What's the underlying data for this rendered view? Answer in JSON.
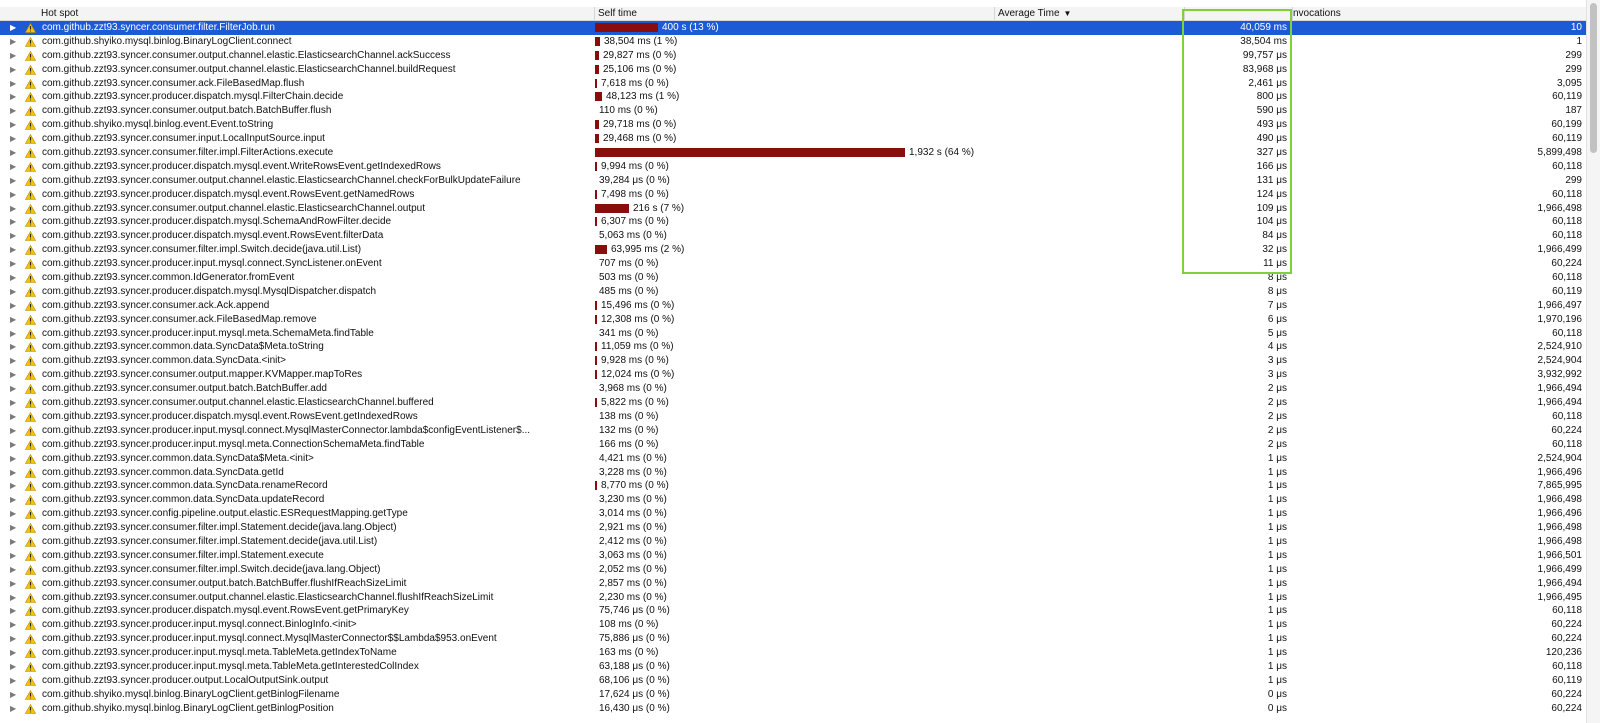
{
  "colors": {
    "selection": "#1d5bd6",
    "bar": "#8a0d0d",
    "highlight": "#7fd13a",
    "warning_icon": "#f5c400"
  },
  "header": {
    "hot_spot": "Hot spot",
    "self_time": "Self time",
    "average_time": "Average Time",
    "sort_icon": "sort-descending-icon",
    "invocations": "nvocations"
  },
  "rows": [
    {
      "method": "com.github.zzt93.syncer.consumer.filter.FilterJob.run",
      "self_time": "400 s (13 %)",
      "self_pct": 13,
      "avg": "40,059 ms",
      "inv": "10"
    },
    {
      "method": "com.github.shyiko.mysql.binlog.BinaryLogClient.connect",
      "self_time": "38,504 ms (1 %)",
      "self_pct": 1,
      "avg": "38,504 ms",
      "inv": "1"
    },
    {
      "method": "com.github.zzt93.syncer.consumer.output.channel.elastic.ElasticsearchChannel.ackSuccess",
      "self_time": "29,827 ms (0 %)",
      "self_pct": 0.9,
      "avg": "99,757 μs",
      "inv": "299"
    },
    {
      "method": "com.github.zzt93.syncer.consumer.output.channel.elastic.ElasticsearchChannel.buildRequest",
      "self_time": "25,106 ms (0 %)",
      "self_pct": 0.8,
      "avg": "83,968 μs",
      "inv": "299"
    },
    {
      "method": "com.github.zzt93.syncer.consumer.ack.FileBasedMap.flush",
      "self_time": "7,618 ms (0 %)",
      "self_pct": 0.25,
      "avg": "2,461 μs",
      "inv": "3,095"
    },
    {
      "method": "com.github.zzt93.syncer.producer.dispatch.mysql.FilterChain.decide",
      "self_time": "48,123 ms (1 %)",
      "self_pct": 1.5,
      "avg": "800 μs",
      "inv": "60,119"
    },
    {
      "method": "com.github.zzt93.syncer.consumer.output.batch.BatchBuffer.flush",
      "self_time": "110 ms (0 %)",
      "self_pct": 0,
      "avg": "590 μs",
      "inv": "187"
    },
    {
      "method": "com.github.shyiko.mysql.binlog.event.Event.toString",
      "self_time": "29,718 ms (0 %)",
      "self_pct": 0.9,
      "avg": "493 μs",
      "inv": "60,199"
    },
    {
      "method": "com.github.zzt93.syncer.consumer.input.LocalInputSource.input",
      "self_time": "29,468 ms (0 %)",
      "self_pct": 0.9,
      "avg": "490 μs",
      "inv": "60,119"
    },
    {
      "method": "com.github.zzt93.syncer.consumer.filter.impl.FilterActions.execute",
      "self_time": "1,932 s (64 %)",
      "self_pct": 64,
      "avg": "327 μs",
      "inv": "5,899,498"
    },
    {
      "method": "com.github.zzt93.syncer.producer.dispatch.mysql.event.WriteRowsEvent.getIndexedRows",
      "self_time": "9,994 ms (0 %)",
      "self_pct": 0.3,
      "avg": "166 μs",
      "inv": "60,118"
    },
    {
      "method": "com.github.zzt93.syncer.consumer.output.channel.elastic.ElasticsearchChannel.checkForBulkUpdateFailure",
      "self_time": "39,284 μs (0 %)",
      "self_pct": 0,
      "avg": "131 μs",
      "inv": "299"
    },
    {
      "method": "com.github.zzt93.syncer.producer.dispatch.mysql.event.RowsEvent.getNamedRows",
      "self_time": "7,498 ms (0 %)",
      "self_pct": 0.25,
      "avg": "124 μs",
      "inv": "60,118"
    },
    {
      "method": "com.github.zzt93.syncer.consumer.output.channel.elastic.ElasticsearchChannel.output",
      "self_time": "216 s (7 %)",
      "self_pct": 7,
      "avg": "109 μs",
      "inv": "1,966,498"
    },
    {
      "method": "com.github.zzt93.syncer.producer.dispatch.mysql.SchemaAndRowFilter.decide",
      "self_time": "6,307 ms (0 %)",
      "self_pct": 0.2,
      "avg": "104 μs",
      "inv": "60,118"
    },
    {
      "method": "com.github.zzt93.syncer.producer.dispatch.mysql.event.RowsEvent.filterData",
      "self_time": "5,063 ms (0 %)",
      "self_pct": 0,
      "avg": "84 μs",
      "inv": "60,118"
    },
    {
      "method": "com.github.zzt93.syncer.consumer.filter.impl.Switch.decide(java.util.List)",
      "self_time": "63,995 ms (2 %)",
      "self_pct": 2.5,
      "avg": "32 μs",
      "inv": "1,966,499"
    },
    {
      "method": "com.github.zzt93.syncer.producer.input.mysql.connect.SyncListener.onEvent",
      "self_time": "707 ms (0 %)",
      "self_pct": 0,
      "avg": "11 μs",
      "inv": "60,224"
    },
    {
      "method": "com.github.zzt93.syncer.common.IdGenerator.fromEvent",
      "self_time": "503 ms (0 %)",
      "self_pct": 0,
      "avg": "8 μs",
      "inv": "60,118"
    },
    {
      "method": "com.github.zzt93.syncer.producer.dispatch.mysql.MysqlDispatcher.dispatch",
      "self_time": "485 ms (0 %)",
      "self_pct": 0,
      "avg": "8 μs",
      "inv": "60,119"
    },
    {
      "method": "com.github.zzt93.syncer.consumer.ack.Ack.append",
      "self_time": "15,496 ms (0 %)",
      "self_pct": 0.4,
      "avg": "7 μs",
      "inv": "1,966,497"
    },
    {
      "method": "com.github.zzt93.syncer.consumer.ack.FileBasedMap.remove",
      "self_time": "12,308 ms (0 %)",
      "self_pct": 0.35,
      "avg": "6 μs",
      "inv": "1,970,196"
    },
    {
      "method": "com.github.zzt93.syncer.producer.input.mysql.meta.SchemaMeta.findTable",
      "self_time": "341 ms (0 %)",
      "self_pct": 0,
      "avg": "5 μs",
      "inv": "60,118"
    },
    {
      "method": "com.github.zzt93.syncer.common.data.SyncData$Meta.toString",
      "self_time": "11,059 ms (0 %)",
      "self_pct": 0.35,
      "avg": "4 μs",
      "inv": "2,524,910"
    },
    {
      "method": "com.github.zzt93.syncer.common.data.SyncData.<init>",
      "self_time": "9,928 ms (0 %)",
      "self_pct": 0.3,
      "avg": "3 μs",
      "inv": "2,524,904"
    },
    {
      "method": "com.github.zzt93.syncer.consumer.output.mapper.KVMapper.mapToRes",
      "self_time": "12,024 ms (0 %)",
      "self_pct": 0.35,
      "avg": "3 μs",
      "inv": "3,932,992"
    },
    {
      "method": "com.github.zzt93.syncer.consumer.output.batch.BatchBuffer.add",
      "self_time": "3,968 ms (0 %)",
      "self_pct": 0,
      "avg": "2 μs",
      "inv": "1,966,494"
    },
    {
      "method": "com.github.zzt93.syncer.consumer.output.channel.elastic.ElasticsearchChannel.buffered",
      "self_time": "5,822 ms (0 %)",
      "self_pct": 0.15,
      "avg": "2 μs",
      "inv": "1,966,494"
    },
    {
      "method": "com.github.zzt93.syncer.producer.dispatch.mysql.event.RowsEvent.getIndexedRows",
      "self_time": "138 ms (0 %)",
      "self_pct": 0,
      "avg": "2 μs",
      "inv": "60,118"
    },
    {
      "method": "com.github.zzt93.syncer.producer.input.mysql.connect.MysqlMasterConnector.lambda$configEventListener$...",
      "self_time": "132 ms (0 %)",
      "self_pct": 0,
      "avg": "2 μs",
      "inv": "60,224"
    },
    {
      "method": "com.github.zzt93.syncer.producer.input.mysql.meta.ConnectionSchemaMeta.findTable",
      "self_time": "166 ms (0 %)",
      "self_pct": 0,
      "avg": "2 μs",
      "inv": "60,118"
    },
    {
      "method": "com.github.zzt93.syncer.common.data.SyncData$Meta.<init>",
      "self_time": "4,421 ms (0 %)",
      "self_pct": 0,
      "avg": "1 μs",
      "inv": "2,524,904"
    },
    {
      "method": "com.github.zzt93.syncer.common.data.SyncData.getId",
      "self_time": "3,228 ms (0 %)",
      "self_pct": 0,
      "avg": "1 μs",
      "inv": "1,966,496"
    },
    {
      "method": "com.github.zzt93.syncer.common.data.SyncData.renameRecord",
      "self_time": "8,770 ms (0 %)",
      "self_pct": 0.25,
      "avg": "1 μs",
      "inv": "7,865,995"
    },
    {
      "method": "com.github.zzt93.syncer.common.data.SyncData.updateRecord",
      "self_time": "3,230 ms (0 %)",
      "self_pct": 0,
      "avg": "1 μs",
      "inv": "1,966,498"
    },
    {
      "method": "com.github.zzt93.syncer.config.pipeline.output.elastic.ESRequestMapping.getType",
      "self_time": "3,014 ms (0 %)",
      "self_pct": 0,
      "avg": "1 μs",
      "inv": "1,966,496"
    },
    {
      "method": "com.github.zzt93.syncer.consumer.filter.impl.Statement.decide(java.lang.Object)",
      "self_time": "2,921 ms (0 %)",
      "self_pct": 0,
      "avg": "1 μs",
      "inv": "1,966,498"
    },
    {
      "method": "com.github.zzt93.syncer.consumer.filter.impl.Statement.decide(java.util.List)",
      "self_time": "2,412 ms (0 %)",
      "self_pct": 0,
      "avg": "1 μs",
      "inv": "1,966,498"
    },
    {
      "method": "com.github.zzt93.syncer.consumer.filter.impl.Statement.execute",
      "self_time": "3,063 ms (0 %)",
      "self_pct": 0,
      "avg": "1 μs",
      "inv": "1,966,501"
    },
    {
      "method": "com.github.zzt93.syncer.consumer.filter.impl.Switch.decide(java.lang.Object)",
      "self_time": "2,052 ms (0 %)",
      "self_pct": 0,
      "avg": "1 μs",
      "inv": "1,966,499"
    },
    {
      "method": "com.github.zzt93.syncer.consumer.output.batch.BatchBuffer.flushIfReachSizeLimit",
      "self_time": "2,857 ms (0 %)",
      "self_pct": 0,
      "avg": "1 μs",
      "inv": "1,966,494"
    },
    {
      "method": "com.github.zzt93.syncer.consumer.output.channel.elastic.ElasticsearchChannel.flushIfReachSizeLimit",
      "self_time": "2,230 ms (0 %)",
      "self_pct": 0,
      "avg": "1 μs",
      "inv": "1,966,495"
    },
    {
      "method": "com.github.zzt93.syncer.producer.dispatch.mysql.event.RowsEvent.getPrimaryKey",
      "self_time": "75,746 μs (0 %)",
      "self_pct": 0,
      "avg": "1 μs",
      "inv": "60,118"
    },
    {
      "method": "com.github.zzt93.syncer.producer.input.mysql.connect.BinlogInfo.<init>",
      "self_time": "108 ms (0 %)",
      "self_pct": 0,
      "avg": "1 μs",
      "inv": "60,224"
    },
    {
      "method": "com.github.zzt93.syncer.producer.input.mysql.connect.MysqlMasterConnector$$Lambda$953.onEvent",
      "self_time": "75,886 μs (0 %)",
      "self_pct": 0,
      "avg": "1 μs",
      "inv": "60,224"
    },
    {
      "method": "com.github.zzt93.syncer.producer.input.mysql.meta.TableMeta.getIndexToName",
      "self_time": "163 ms (0 %)",
      "self_pct": 0,
      "avg": "1 μs",
      "inv": "120,236"
    },
    {
      "method": "com.github.zzt93.syncer.producer.input.mysql.meta.TableMeta.getInterestedColIndex",
      "self_time": "63,188 μs (0 %)",
      "self_pct": 0,
      "avg": "1 μs",
      "inv": "60,118"
    },
    {
      "method": "com.github.zzt93.syncer.producer.output.LocalOutputSink.output",
      "self_time": "68,106 μs (0 %)",
      "self_pct": 0,
      "avg": "1 μs",
      "inv": "60,119"
    },
    {
      "method": "com.github.shyiko.mysql.binlog.BinaryLogClient.getBinlogFilename",
      "self_time": "17,624 μs (0 %)",
      "self_pct": 0,
      "avg": "0 μs",
      "inv": "60,224"
    },
    {
      "method": "com.github.shyiko.mysql.binlog.BinaryLogClient.getBinlogPosition",
      "self_time": "16,430 μs (0 %)",
      "self_pct": 0,
      "avg": "0 μs",
      "inv": "60,224"
    }
  ],
  "selected_row": 0
}
